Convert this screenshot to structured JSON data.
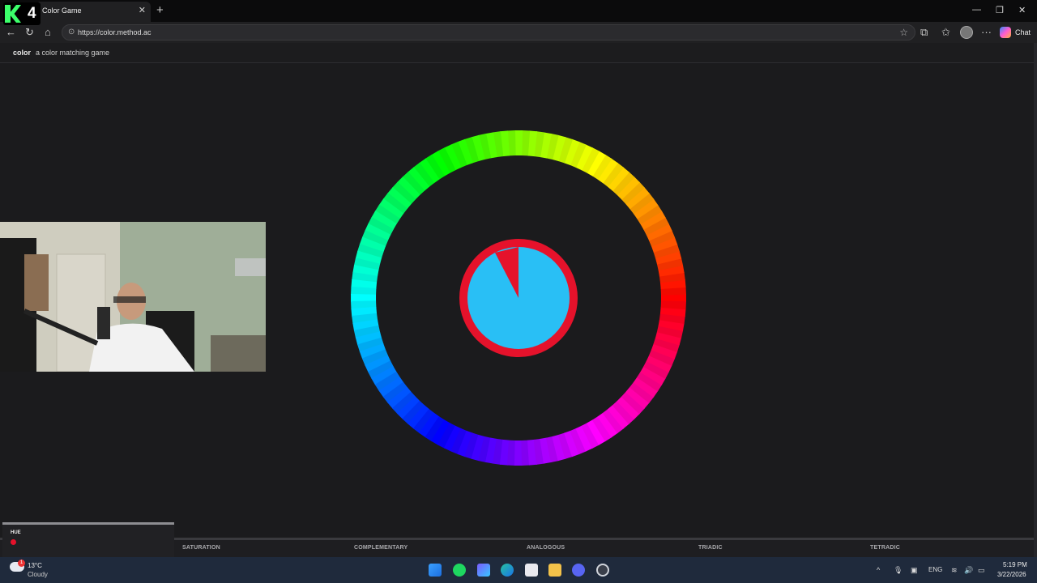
{
  "browser": {
    "tab_title": "Color Game",
    "url": "https://color.method.ac",
    "chat_label": "Chat"
  },
  "page": {
    "brand": "color",
    "tagline": "a color matching game"
  },
  "game": {
    "ring_color": "#e5122b",
    "inner_color": "#29bff5",
    "mode_tabs": [
      {
        "label": "HUE",
        "active": true
      },
      {
        "label": "SATURATION"
      },
      {
        "label": "COMPLEMENTARY"
      },
      {
        "label": "ANALOGOUS"
      },
      {
        "label": "TRIADIC"
      },
      {
        "label": "TETRADIC"
      }
    ]
  },
  "taskbar": {
    "temperature": "13°C",
    "condition": "Cloudy",
    "weather_badge": "1",
    "language": "ENG",
    "time": "5:19 PM",
    "date": "3/22/2026"
  }
}
